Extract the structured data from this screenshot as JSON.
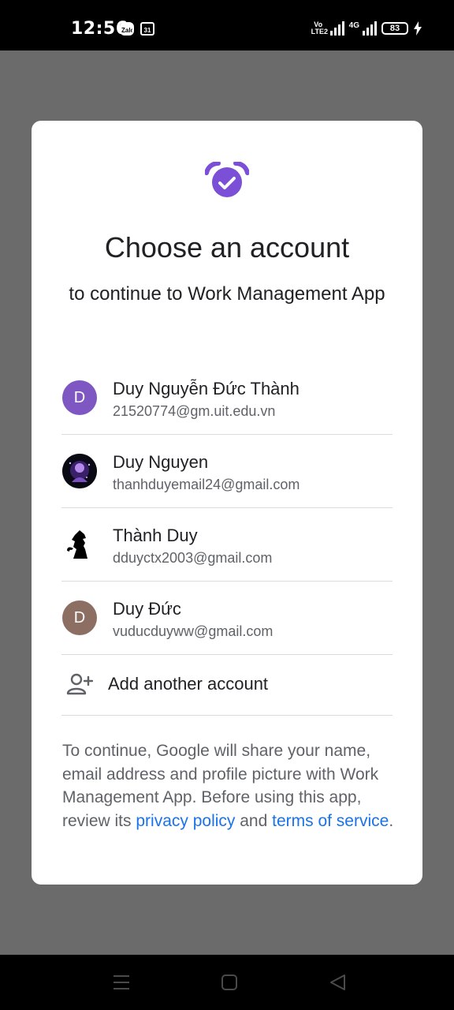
{
  "status_bar": {
    "time": "12:56",
    "notifications": [
      "Zalo",
      "31"
    ],
    "volte": "Vo LTE2",
    "network": "4G",
    "battery": "83"
  },
  "dialog": {
    "title": "Choose an account",
    "subtitle": "to continue to Work Management App",
    "accounts": [
      {
        "name": "Duy Nguyễn Đức Thành",
        "email": "21520774@gm.uit.edu.vn",
        "avatar_initial": "D",
        "avatar_color": "#7e57c2"
      },
      {
        "name": "Duy Nguyen",
        "email": "thanhduyemail24@gmail.com",
        "avatar_initial": "",
        "avatar_color": "#000000"
      },
      {
        "name": "Thành Duy",
        "email": "dduyctx2003@gmail.com",
        "avatar_initial": "",
        "avatar_color": "#ffffff"
      },
      {
        "name": "Duy Đức",
        "email": "vuducduyww@gmail.com",
        "avatar_initial": "D",
        "avatar_color": "#8d6e63"
      }
    ],
    "add_account_label": "Add another account",
    "disclaimer": {
      "text_before": "To continue, Google will share your name, email address and profile picture with Work Management App. Before using this app, review its ",
      "privacy_link": "privacy policy",
      "and": " and ",
      "terms_link": "terms of service",
      "end": "."
    }
  },
  "nav_bar": {
    "buttons": [
      "menu-icon",
      "home-icon",
      "back-icon"
    ]
  },
  "colors": {
    "accent": "#1a73e8",
    "brand_purple": "#7b4fd6",
    "scrim": "#6b6b6b"
  }
}
